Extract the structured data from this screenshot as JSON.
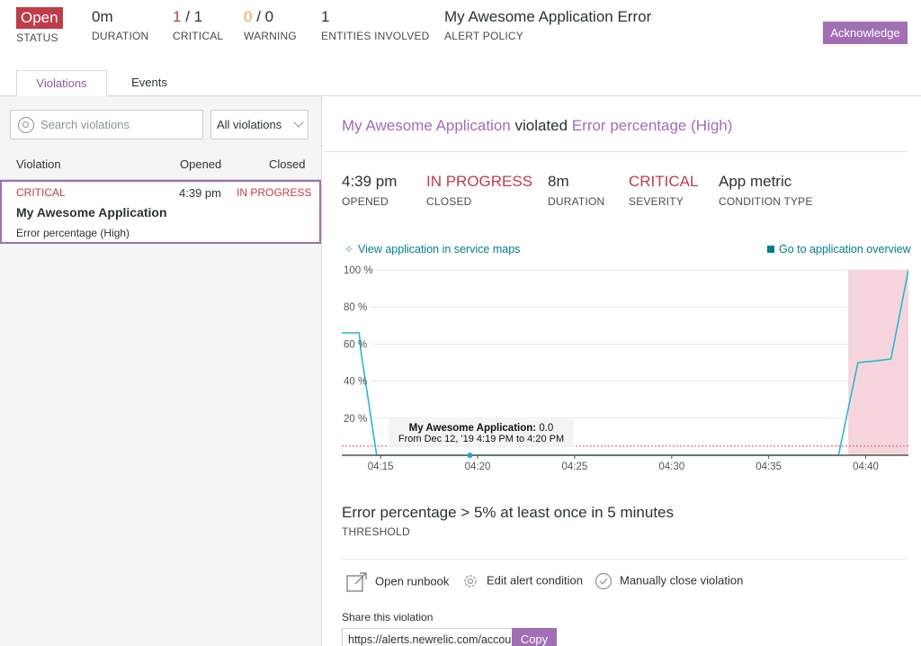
{
  "header": {
    "status": {
      "value": "Open",
      "label": "STATUS"
    },
    "duration": {
      "value": "0m",
      "label": "DURATION"
    },
    "critical": {
      "count": "1",
      "sep": " / ",
      "total": "1",
      "label": "CRITICAL"
    },
    "warning": {
      "count": "0",
      "sep": " / ",
      "total": "0",
      "label": "WARNING"
    },
    "entities": {
      "value": "1",
      "label": "ENTITIES INVOLVED"
    },
    "policy": {
      "value": "My Awesome Application Error",
      "label": "ALERT POLICY"
    },
    "acknowledge_label": "Acknowledge"
  },
  "tabs": [
    {
      "label": "Violations",
      "active": true
    },
    {
      "label": "Events",
      "active": false
    }
  ],
  "sidebar": {
    "search_placeholder": "Search violations",
    "filter_value": "All violations",
    "columns": [
      "Violation",
      "Opened",
      "Closed"
    ],
    "violations": [
      {
        "severity": "CRITICAL",
        "opened": "4:39 pm",
        "closed": "IN PROGRESS",
        "name": "My Awesome Application",
        "condition": "Error percentage (High)"
      }
    ]
  },
  "detail": {
    "entity": "My Awesome Application",
    "verb": "violated",
    "condition": "Error percentage (High)",
    "stats": [
      {
        "value": "4:39 pm",
        "label": "OPENED",
        "color": "#2a3434"
      },
      {
        "value": "IN PROGRESS",
        "label": "CLOSED",
        "color": "#bf3c4a"
      },
      {
        "value": "8m",
        "label": "DURATION",
        "color": "#2a3434"
      },
      {
        "value": "CRITICAL",
        "label": "SEVERITY",
        "color": "#bf3c4a"
      },
      {
        "value": "App metric",
        "label": "CONDITION TYPE",
        "color": "#2a3434"
      }
    ],
    "link_service_maps": "View application in service maps",
    "link_app_overview": "Go to application overview",
    "threshold_text": "Error percentage > 5% at least once in 5 minutes",
    "threshold_label": "THRESHOLD",
    "actions": {
      "runbook": "Open runbook",
      "edit": "Edit alert condition",
      "close": "Manually close violation"
    },
    "share_label": "Share this violation",
    "share_url": "https://alerts.newrelic.com/accou",
    "copy_label": "Copy"
  },
  "chart_data": {
    "type": "line",
    "ylim": [
      0,
      100
    ],
    "yticks": [
      "20 %",
      "40 %",
      "60 %",
      "80 %",
      "100 %"
    ],
    "xticks": [
      "04:15",
      "04:20",
      "04:25",
      "04:30",
      "04:35",
      "04:40"
    ],
    "threshold": 5,
    "x_minutes": [
      13.0,
      13.9,
      14.0,
      14.8,
      38.6,
      39.6,
      40.6,
      41.3,
      42.2
    ],
    "y_values": [
      66,
      66,
      55,
      0,
      0,
      50,
      51,
      52,
      100
    ],
    "violation_start_minutes": 39.1,
    "tooltip": {
      "title": "My Awesome Application:",
      "value": "0.0",
      "range": "From Dec 12, '19 4:19 PM to 4:20 PM"
    },
    "colors": {
      "line": "#29b6d6",
      "threshold": "#e04b5a",
      "violation": "#f6d6dc"
    }
  }
}
